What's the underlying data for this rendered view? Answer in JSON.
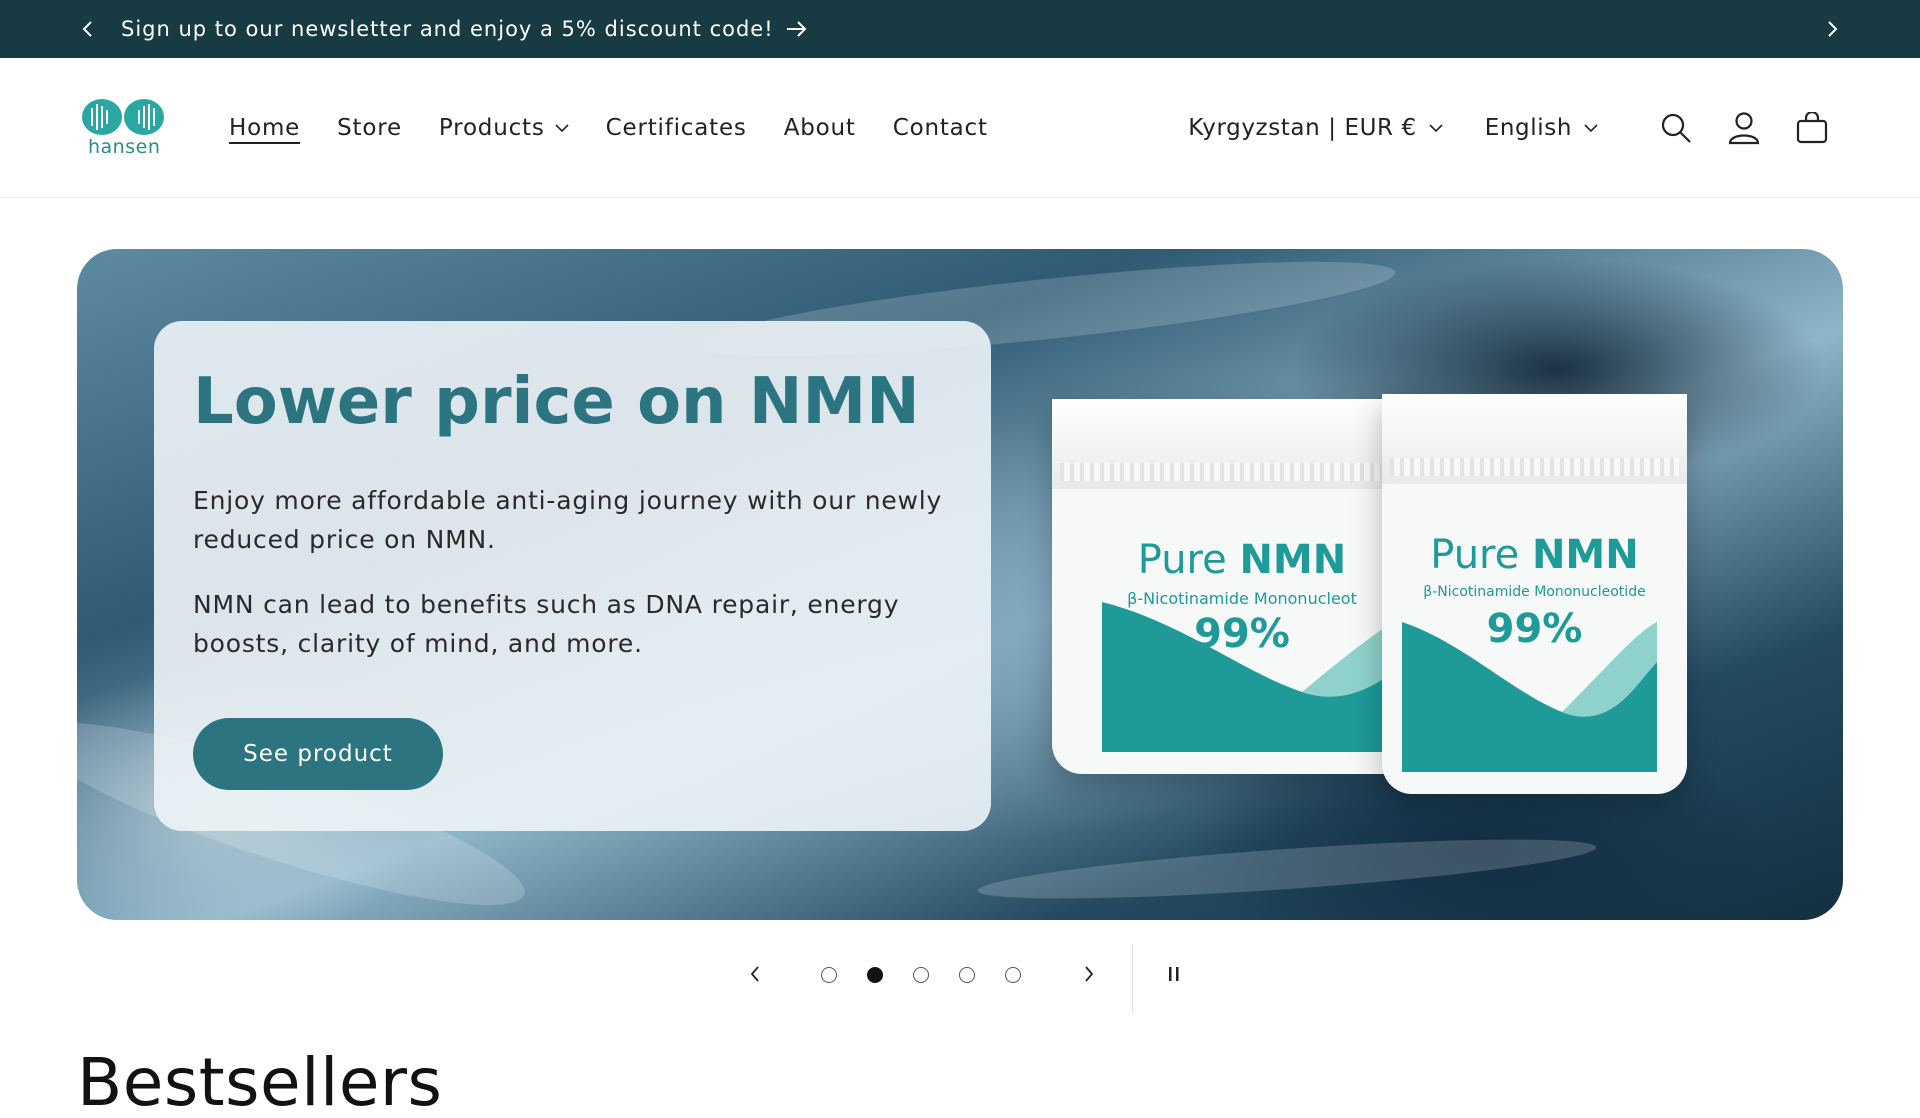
{
  "announcement": {
    "text": "Sign up to our newsletter and enjoy a 5% discount code!",
    "bg_color": "#183a43"
  },
  "header": {
    "logo_text": "hansen",
    "nav": [
      {
        "label": "Home",
        "active": true
      },
      {
        "label": "Store"
      },
      {
        "label": "Products",
        "has_dropdown": true
      },
      {
        "label": "Certificates"
      },
      {
        "label": "About"
      },
      {
        "label": "Contact"
      }
    ],
    "country_selector": "Kyrgyzstan | EUR €",
    "language_selector": "English",
    "icons": [
      "search-icon",
      "account-icon",
      "cart-icon"
    ]
  },
  "hero": {
    "title": "Lower price on NMN",
    "paragraph1": "Enjoy more affordable anti-aging journey with our newly reduced price on NMN.",
    "paragraph2": "NMN can lead to benefits such as DNA repair, energy boosts, clarity of mind, and more.",
    "cta_label": "See product",
    "accent_color": "#2b7480",
    "product": {
      "name_light": "Pure ",
      "name_bold": "NMN",
      "subtitle_left": "β-Nicotinamide Mononucleot",
      "subtitle_right": "β-Nicotinamide Mononucleotide",
      "purity": "99%"
    }
  },
  "slider": {
    "total_slides": 5,
    "active_slide": 2
  },
  "bestsellers": {
    "title": "Bestsellers"
  }
}
